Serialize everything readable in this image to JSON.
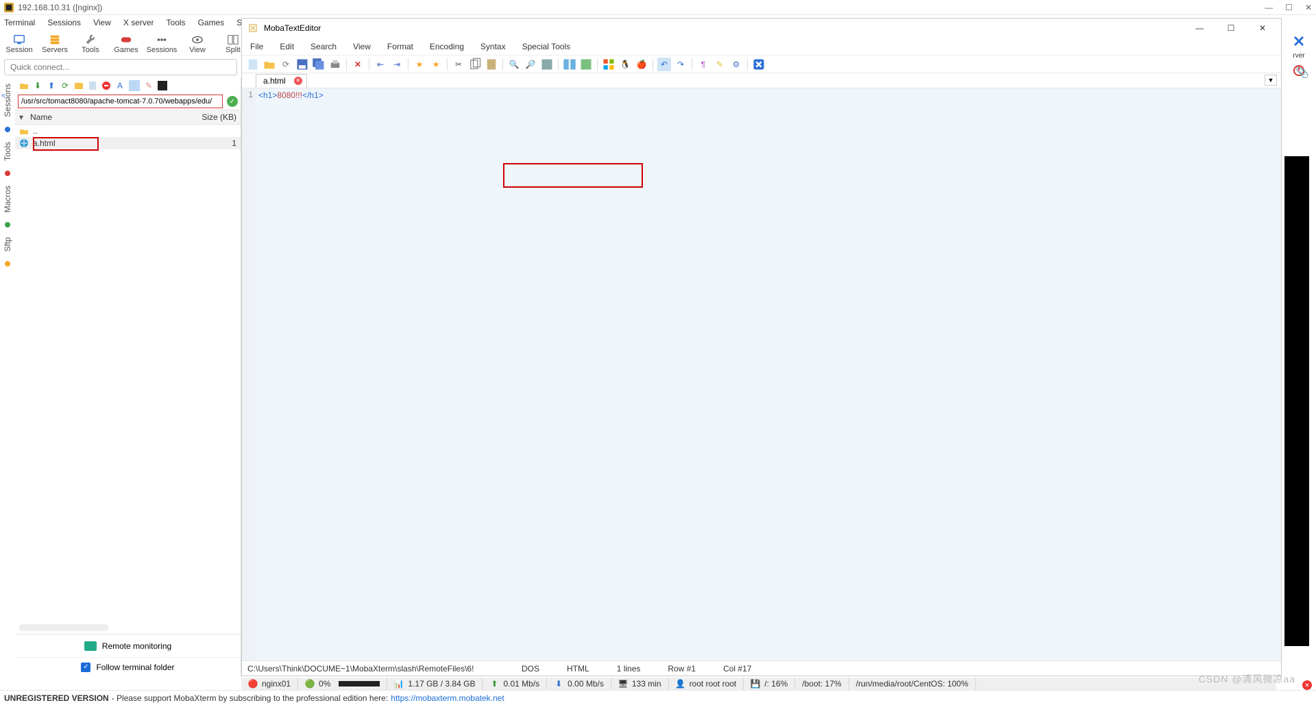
{
  "window": {
    "title": "192.168.10.31 ([nginx])"
  },
  "menubar": [
    "Terminal",
    "Sessions",
    "View",
    "X server",
    "Tools",
    "Games",
    "Settings"
  ],
  "toolbar": [
    {
      "label": "Session",
      "icon": "monitor"
    },
    {
      "label": "Servers",
      "icon": "servers"
    },
    {
      "label": "Tools",
      "icon": "wrench"
    },
    {
      "label": "Games",
      "icon": "gamepad"
    },
    {
      "label": "Sessions",
      "icon": "dots"
    },
    {
      "label": "View",
      "icon": "eye"
    },
    {
      "label": "Split",
      "icon": "split"
    }
  ],
  "right_tools": [
    {
      "label": "rver",
      "icon": "x"
    },
    {
      "label": "Exit",
      "icon": "power"
    }
  ],
  "quick_connect_placeholder": "Quick connect...",
  "vtabs": [
    {
      "label": "Sessions",
      "color": "#2a6fd6"
    },
    {
      "label": "Tools",
      "color": "#d83b3b"
    },
    {
      "label": "Macros",
      "color": "#3aa24a"
    },
    {
      "label": "Sftp",
      "color": "#f5a623"
    }
  ],
  "sftp": {
    "path": "/usr/src/tomact8080/apache-tomcat-7.0.70/webapps/edu/",
    "columns": {
      "name": "Name",
      "size": "Size (KB)"
    },
    "rows": [
      {
        "name": "..",
        "size": "",
        "icon": "folder-up"
      },
      {
        "name": "a.html",
        "size": "1",
        "icon": "html"
      }
    ],
    "remote_monitoring": "Remote monitoring",
    "follow": "Follow terminal folder"
  },
  "editor": {
    "title": "MobaTextEditor",
    "menu": [
      "File",
      "Edit",
      "Search",
      "View",
      "Format",
      "Encoding",
      "Syntax",
      "Special Tools"
    ],
    "tab": "a.html",
    "line_no": "1",
    "code_open": "<h1>",
    "code_text": "8080!!!",
    "code_close": "</h1>",
    "status": {
      "path": "C:\\Users\\Think\\DOCUME~1\\MobaXterm\\slash\\RemoteFiles\\6!",
      "enc": "DOS",
      "lang": "HTML",
      "lines": "1 lines",
      "row": "Row #1",
      "col": "Col #17"
    }
  },
  "bottom_status": {
    "session": "nginx01",
    "cpu": "0%",
    "mem": "1.17 GB / 3.84 GB",
    "up": "0.01 Mb/s",
    "down": "0.00 Mb/s",
    "uptime": "133 min",
    "user": "root  root  root",
    "disk1": "/: 16%",
    "disk2": "/boot: 17%",
    "disk3": "/run/media/root/CentOS: 100%"
  },
  "footer": {
    "unreg": "UNREGISTERED VERSION",
    "msg": "  -  Please support MobaXterm by subscribing to the professional edition here:  ",
    "url": "https://mobaxterm.mobatek.net"
  },
  "watermark": "CSDN @清风微凉aa"
}
